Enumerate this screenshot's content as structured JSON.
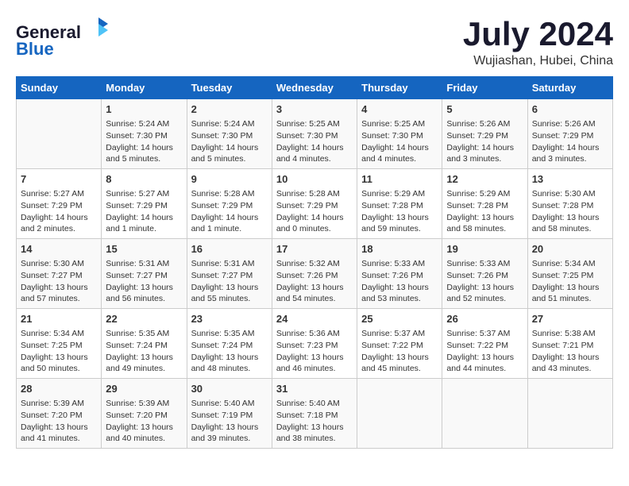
{
  "header": {
    "logo_line1": "General",
    "logo_line2": "Blue",
    "month_title": "July 2024",
    "location": "Wujiashan, Hubei, China"
  },
  "weekdays": [
    "Sunday",
    "Monday",
    "Tuesday",
    "Wednesday",
    "Thursday",
    "Friday",
    "Saturday"
  ],
  "weeks": [
    [
      {
        "day": "",
        "info": ""
      },
      {
        "day": "1",
        "info": "Sunrise: 5:24 AM\nSunset: 7:30 PM\nDaylight: 14 hours\nand 5 minutes."
      },
      {
        "day": "2",
        "info": "Sunrise: 5:24 AM\nSunset: 7:30 PM\nDaylight: 14 hours\nand 5 minutes."
      },
      {
        "day": "3",
        "info": "Sunrise: 5:25 AM\nSunset: 7:30 PM\nDaylight: 14 hours\nand 4 minutes."
      },
      {
        "day": "4",
        "info": "Sunrise: 5:25 AM\nSunset: 7:30 PM\nDaylight: 14 hours\nand 4 minutes."
      },
      {
        "day": "5",
        "info": "Sunrise: 5:26 AM\nSunset: 7:29 PM\nDaylight: 14 hours\nand 3 minutes."
      },
      {
        "day": "6",
        "info": "Sunrise: 5:26 AM\nSunset: 7:29 PM\nDaylight: 14 hours\nand 3 minutes."
      }
    ],
    [
      {
        "day": "7",
        "info": "Sunrise: 5:27 AM\nSunset: 7:29 PM\nDaylight: 14 hours\nand 2 minutes."
      },
      {
        "day": "8",
        "info": "Sunrise: 5:27 AM\nSunset: 7:29 PM\nDaylight: 14 hours\nand 1 minute."
      },
      {
        "day": "9",
        "info": "Sunrise: 5:28 AM\nSunset: 7:29 PM\nDaylight: 14 hours\nand 1 minute."
      },
      {
        "day": "10",
        "info": "Sunrise: 5:28 AM\nSunset: 7:29 PM\nDaylight: 14 hours\nand 0 minutes."
      },
      {
        "day": "11",
        "info": "Sunrise: 5:29 AM\nSunset: 7:28 PM\nDaylight: 13 hours\nand 59 minutes."
      },
      {
        "day": "12",
        "info": "Sunrise: 5:29 AM\nSunset: 7:28 PM\nDaylight: 13 hours\nand 58 minutes."
      },
      {
        "day": "13",
        "info": "Sunrise: 5:30 AM\nSunset: 7:28 PM\nDaylight: 13 hours\nand 58 minutes."
      }
    ],
    [
      {
        "day": "14",
        "info": "Sunrise: 5:30 AM\nSunset: 7:27 PM\nDaylight: 13 hours\nand 57 minutes."
      },
      {
        "day": "15",
        "info": "Sunrise: 5:31 AM\nSunset: 7:27 PM\nDaylight: 13 hours\nand 56 minutes."
      },
      {
        "day": "16",
        "info": "Sunrise: 5:31 AM\nSunset: 7:27 PM\nDaylight: 13 hours\nand 55 minutes."
      },
      {
        "day": "17",
        "info": "Sunrise: 5:32 AM\nSunset: 7:26 PM\nDaylight: 13 hours\nand 54 minutes."
      },
      {
        "day": "18",
        "info": "Sunrise: 5:33 AM\nSunset: 7:26 PM\nDaylight: 13 hours\nand 53 minutes."
      },
      {
        "day": "19",
        "info": "Sunrise: 5:33 AM\nSunset: 7:26 PM\nDaylight: 13 hours\nand 52 minutes."
      },
      {
        "day": "20",
        "info": "Sunrise: 5:34 AM\nSunset: 7:25 PM\nDaylight: 13 hours\nand 51 minutes."
      }
    ],
    [
      {
        "day": "21",
        "info": "Sunrise: 5:34 AM\nSunset: 7:25 PM\nDaylight: 13 hours\nand 50 minutes."
      },
      {
        "day": "22",
        "info": "Sunrise: 5:35 AM\nSunset: 7:24 PM\nDaylight: 13 hours\nand 49 minutes."
      },
      {
        "day": "23",
        "info": "Sunrise: 5:35 AM\nSunset: 7:24 PM\nDaylight: 13 hours\nand 48 minutes."
      },
      {
        "day": "24",
        "info": "Sunrise: 5:36 AM\nSunset: 7:23 PM\nDaylight: 13 hours\nand 46 minutes."
      },
      {
        "day": "25",
        "info": "Sunrise: 5:37 AM\nSunset: 7:22 PM\nDaylight: 13 hours\nand 45 minutes."
      },
      {
        "day": "26",
        "info": "Sunrise: 5:37 AM\nSunset: 7:22 PM\nDaylight: 13 hours\nand 44 minutes."
      },
      {
        "day": "27",
        "info": "Sunrise: 5:38 AM\nSunset: 7:21 PM\nDaylight: 13 hours\nand 43 minutes."
      }
    ],
    [
      {
        "day": "28",
        "info": "Sunrise: 5:39 AM\nSunset: 7:20 PM\nDaylight: 13 hours\nand 41 minutes."
      },
      {
        "day": "29",
        "info": "Sunrise: 5:39 AM\nSunset: 7:20 PM\nDaylight: 13 hours\nand 40 minutes."
      },
      {
        "day": "30",
        "info": "Sunrise: 5:40 AM\nSunset: 7:19 PM\nDaylight: 13 hours\nand 39 minutes."
      },
      {
        "day": "31",
        "info": "Sunrise: 5:40 AM\nSunset: 7:18 PM\nDaylight: 13 hours\nand 38 minutes."
      },
      {
        "day": "",
        "info": ""
      },
      {
        "day": "",
        "info": ""
      },
      {
        "day": "",
        "info": ""
      }
    ]
  ]
}
